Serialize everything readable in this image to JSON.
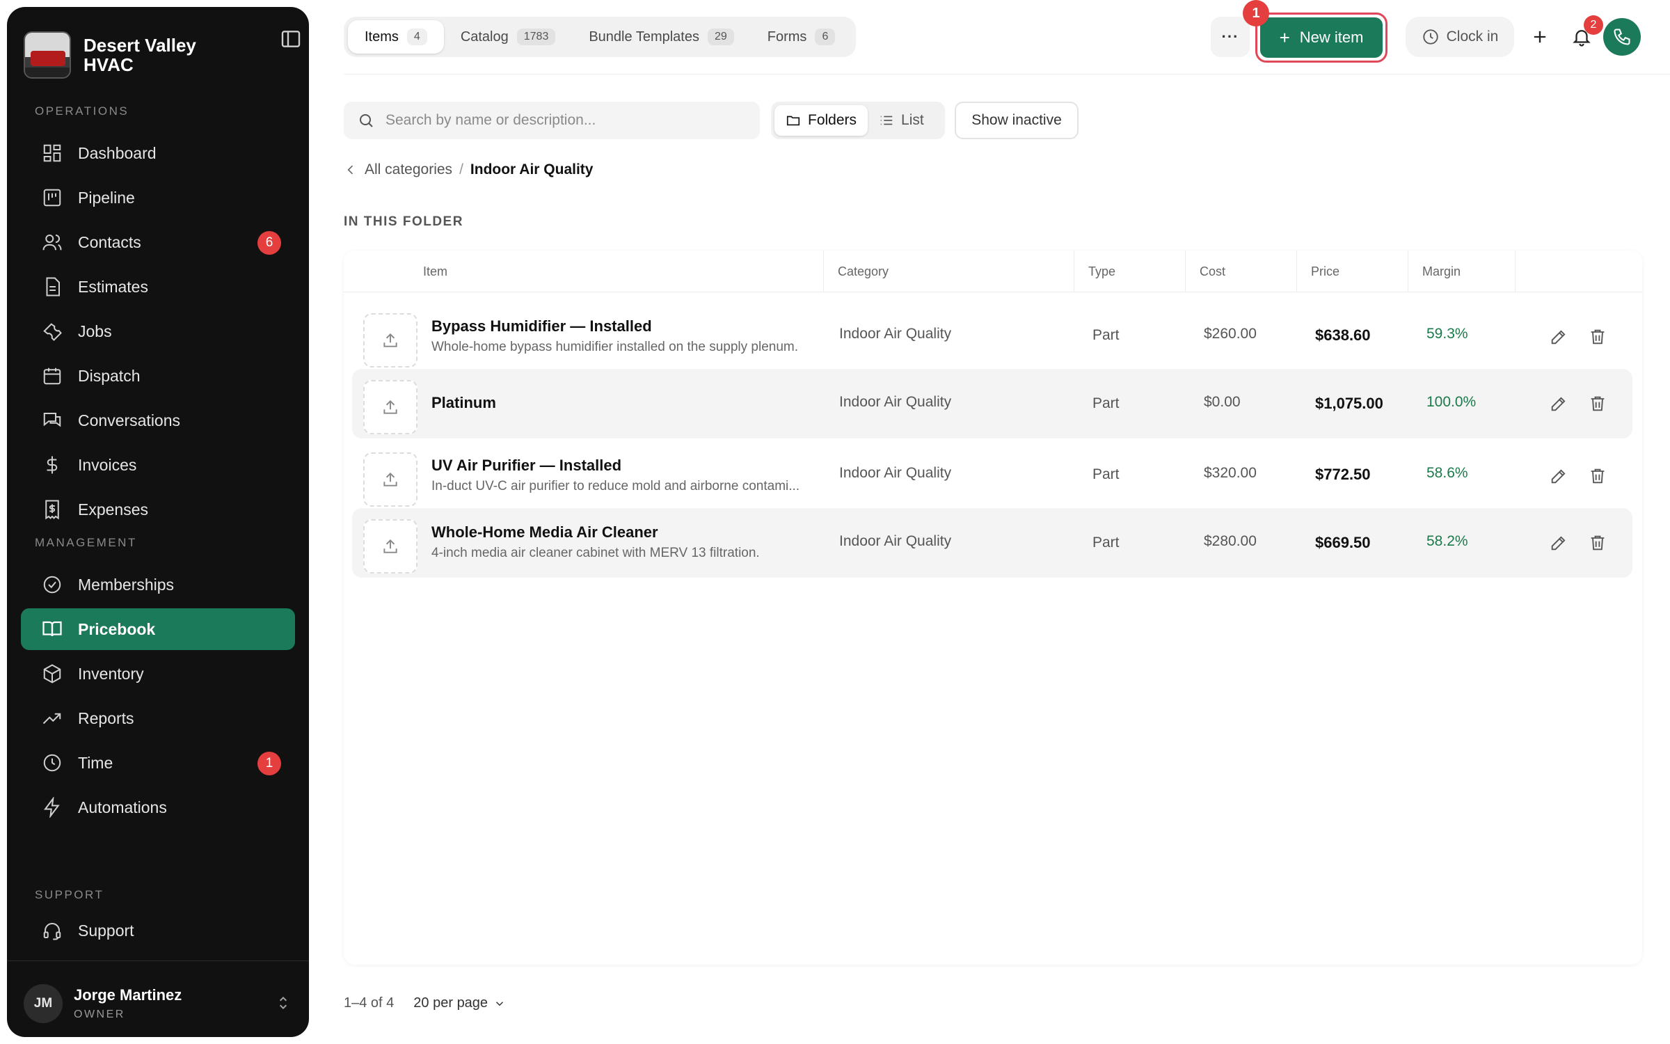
{
  "brand": {
    "name": "Desert Valley HVAC"
  },
  "sidebar": {
    "sections": {
      "operations": "OPERATIONS",
      "management": "MANAGEMENT",
      "support": "SUPPORT"
    },
    "items": [
      {
        "label": "Dashboard",
        "icon": "dashboard-icon"
      },
      {
        "label": "Pipeline",
        "icon": "pipeline-icon"
      },
      {
        "label": "Contacts",
        "icon": "contacts-icon",
        "badge": "6"
      },
      {
        "label": "Estimates",
        "icon": "estimates-icon"
      },
      {
        "label": "Jobs",
        "icon": "wrench-icon"
      },
      {
        "label": "Dispatch",
        "icon": "calendar-icon"
      },
      {
        "label": "Conversations",
        "icon": "chat-icon"
      },
      {
        "label": "Invoices",
        "icon": "dollar-icon"
      },
      {
        "label": "Expenses",
        "icon": "receipt-icon"
      },
      {
        "label": "Memberships",
        "icon": "check-circle-icon"
      },
      {
        "label": "Pricebook",
        "icon": "book-icon",
        "active": true
      },
      {
        "label": "Inventory",
        "icon": "box-icon"
      },
      {
        "label": "Reports",
        "icon": "trend-icon"
      },
      {
        "label": "Time",
        "icon": "clock-icon",
        "badge": "1"
      },
      {
        "label": "Automations",
        "icon": "bolt-icon"
      },
      {
        "label": "Support",
        "icon": "headset-icon"
      }
    ],
    "user": {
      "initials": "JM",
      "name": "Jorge Martinez",
      "role": "OWNER"
    }
  },
  "tabs": [
    {
      "label": "Items",
      "count": "4",
      "active": true
    },
    {
      "label": "Catalog",
      "count": "1783"
    },
    {
      "label": "Bundle Templates",
      "count": "29"
    },
    {
      "label": "Forms",
      "count": "6"
    }
  ],
  "header": {
    "more_label": "···",
    "new_item_label": "New item",
    "step_marker": "1",
    "clock_in_label": "Clock in",
    "notification_count": "2"
  },
  "toolbar": {
    "search_placeholder": "Search by name or description...",
    "folders_label": "Folders",
    "list_label": "List",
    "show_inactive_label": "Show inactive"
  },
  "breadcrumb": {
    "parent": "All categories",
    "separator": "/",
    "current": "Indoor Air Quality"
  },
  "folder_label": "IN THIS FOLDER",
  "table": {
    "columns": [
      "Item",
      "Category",
      "Type",
      "Cost",
      "Price",
      "Margin"
    ],
    "rows": [
      {
        "name": "Bypass Humidifier — Installed",
        "description": "Whole-home bypass humidifier installed on the supply plenum.",
        "category": "Indoor Air Quality",
        "type": "Part",
        "cost": "$260.00",
        "price": "$638.60",
        "margin": "59.3%"
      },
      {
        "name": "Platinum",
        "description": "",
        "category": "Indoor Air Quality",
        "type": "Part",
        "cost": "$0.00",
        "price": "$1,075.00",
        "margin": "100.0%"
      },
      {
        "name": "UV Air Purifier — Installed",
        "description": "In-duct UV-C air purifier to reduce mold and airborne contami...",
        "category": "Indoor Air Quality",
        "type": "Part",
        "cost": "$320.00",
        "price": "$772.50",
        "margin": "58.6%"
      },
      {
        "name": "Whole-Home Media Air Cleaner",
        "description": "4-inch media air cleaner cabinet with MERV 13 filtration.",
        "category": "Indoor Air Quality",
        "type": "Part",
        "cost": "$280.00",
        "price": "$669.50",
        "margin": "58.2%"
      }
    ]
  },
  "pagination": {
    "range": "1–4 of 4",
    "per_page": "20 per page"
  },
  "colors": {
    "accent": "#1b7a5a",
    "badge": "#e53e3e",
    "margin_text": "#1b7a4a",
    "sidebar_bg": "#111111"
  }
}
